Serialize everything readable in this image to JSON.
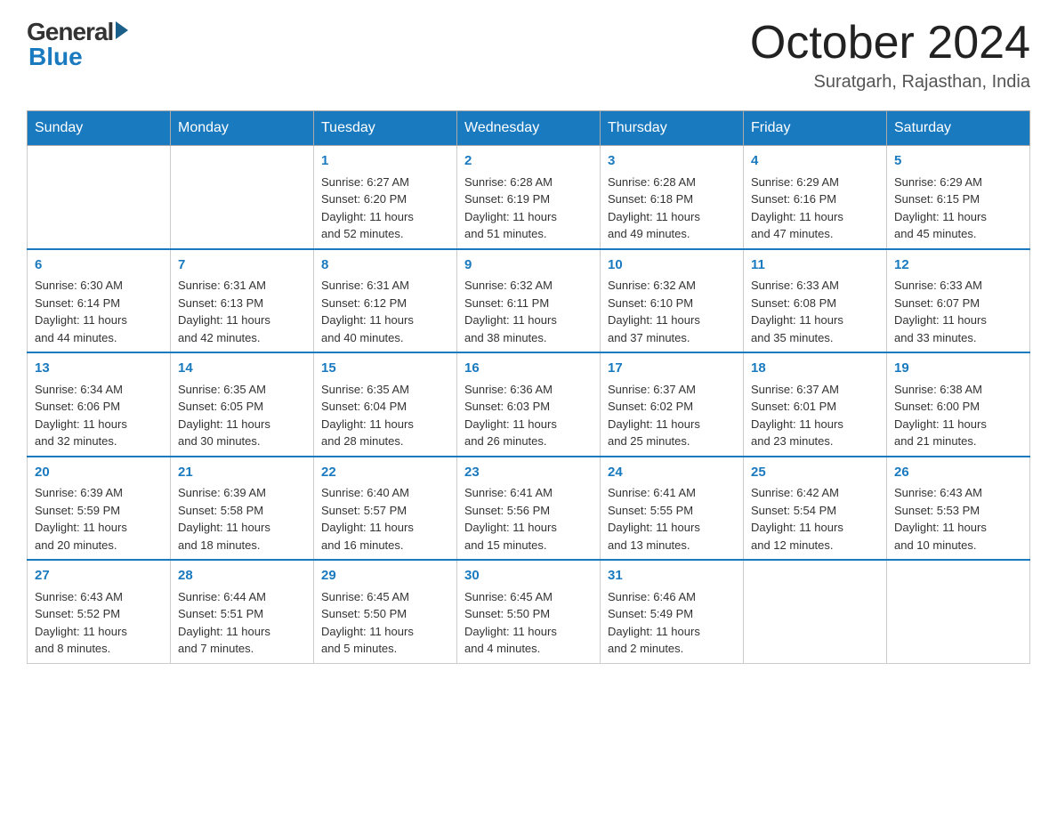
{
  "logo": {
    "general": "General",
    "blue": "Blue"
  },
  "title": "October 2024",
  "location": "Suratgarh, Rajasthan, India",
  "weekdays": [
    "Sunday",
    "Monday",
    "Tuesday",
    "Wednesday",
    "Thursday",
    "Friday",
    "Saturday"
  ],
  "weeks": [
    [
      {
        "day": "",
        "info": ""
      },
      {
        "day": "",
        "info": ""
      },
      {
        "day": "1",
        "info": "Sunrise: 6:27 AM\nSunset: 6:20 PM\nDaylight: 11 hours\nand 52 minutes."
      },
      {
        "day": "2",
        "info": "Sunrise: 6:28 AM\nSunset: 6:19 PM\nDaylight: 11 hours\nand 51 minutes."
      },
      {
        "day": "3",
        "info": "Sunrise: 6:28 AM\nSunset: 6:18 PM\nDaylight: 11 hours\nand 49 minutes."
      },
      {
        "day": "4",
        "info": "Sunrise: 6:29 AM\nSunset: 6:16 PM\nDaylight: 11 hours\nand 47 minutes."
      },
      {
        "day": "5",
        "info": "Sunrise: 6:29 AM\nSunset: 6:15 PM\nDaylight: 11 hours\nand 45 minutes."
      }
    ],
    [
      {
        "day": "6",
        "info": "Sunrise: 6:30 AM\nSunset: 6:14 PM\nDaylight: 11 hours\nand 44 minutes."
      },
      {
        "day": "7",
        "info": "Sunrise: 6:31 AM\nSunset: 6:13 PM\nDaylight: 11 hours\nand 42 minutes."
      },
      {
        "day": "8",
        "info": "Sunrise: 6:31 AM\nSunset: 6:12 PM\nDaylight: 11 hours\nand 40 minutes."
      },
      {
        "day": "9",
        "info": "Sunrise: 6:32 AM\nSunset: 6:11 PM\nDaylight: 11 hours\nand 38 minutes."
      },
      {
        "day": "10",
        "info": "Sunrise: 6:32 AM\nSunset: 6:10 PM\nDaylight: 11 hours\nand 37 minutes."
      },
      {
        "day": "11",
        "info": "Sunrise: 6:33 AM\nSunset: 6:08 PM\nDaylight: 11 hours\nand 35 minutes."
      },
      {
        "day": "12",
        "info": "Sunrise: 6:33 AM\nSunset: 6:07 PM\nDaylight: 11 hours\nand 33 minutes."
      }
    ],
    [
      {
        "day": "13",
        "info": "Sunrise: 6:34 AM\nSunset: 6:06 PM\nDaylight: 11 hours\nand 32 minutes."
      },
      {
        "day": "14",
        "info": "Sunrise: 6:35 AM\nSunset: 6:05 PM\nDaylight: 11 hours\nand 30 minutes."
      },
      {
        "day": "15",
        "info": "Sunrise: 6:35 AM\nSunset: 6:04 PM\nDaylight: 11 hours\nand 28 minutes."
      },
      {
        "day": "16",
        "info": "Sunrise: 6:36 AM\nSunset: 6:03 PM\nDaylight: 11 hours\nand 26 minutes."
      },
      {
        "day": "17",
        "info": "Sunrise: 6:37 AM\nSunset: 6:02 PM\nDaylight: 11 hours\nand 25 minutes."
      },
      {
        "day": "18",
        "info": "Sunrise: 6:37 AM\nSunset: 6:01 PM\nDaylight: 11 hours\nand 23 minutes."
      },
      {
        "day": "19",
        "info": "Sunrise: 6:38 AM\nSunset: 6:00 PM\nDaylight: 11 hours\nand 21 minutes."
      }
    ],
    [
      {
        "day": "20",
        "info": "Sunrise: 6:39 AM\nSunset: 5:59 PM\nDaylight: 11 hours\nand 20 minutes."
      },
      {
        "day": "21",
        "info": "Sunrise: 6:39 AM\nSunset: 5:58 PM\nDaylight: 11 hours\nand 18 minutes."
      },
      {
        "day": "22",
        "info": "Sunrise: 6:40 AM\nSunset: 5:57 PM\nDaylight: 11 hours\nand 16 minutes."
      },
      {
        "day": "23",
        "info": "Sunrise: 6:41 AM\nSunset: 5:56 PM\nDaylight: 11 hours\nand 15 minutes."
      },
      {
        "day": "24",
        "info": "Sunrise: 6:41 AM\nSunset: 5:55 PM\nDaylight: 11 hours\nand 13 minutes."
      },
      {
        "day": "25",
        "info": "Sunrise: 6:42 AM\nSunset: 5:54 PM\nDaylight: 11 hours\nand 12 minutes."
      },
      {
        "day": "26",
        "info": "Sunrise: 6:43 AM\nSunset: 5:53 PM\nDaylight: 11 hours\nand 10 minutes."
      }
    ],
    [
      {
        "day": "27",
        "info": "Sunrise: 6:43 AM\nSunset: 5:52 PM\nDaylight: 11 hours\nand 8 minutes."
      },
      {
        "day": "28",
        "info": "Sunrise: 6:44 AM\nSunset: 5:51 PM\nDaylight: 11 hours\nand 7 minutes."
      },
      {
        "day": "29",
        "info": "Sunrise: 6:45 AM\nSunset: 5:50 PM\nDaylight: 11 hours\nand 5 minutes."
      },
      {
        "day": "30",
        "info": "Sunrise: 6:45 AM\nSunset: 5:50 PM\nDaylight: 11 hours\nand 4 minutes."
      },
      {
        "day": "31",
        "info": "Sunrise: 6:46 AM\nSunset: 5:49 PM\nDaylight: 11 hours\nand 2 minutes."
      },
      {
        "day": "",
        "info": ""
      },
      {
        "day": "",
        "info": ""
      }
    ]
  ]
}
